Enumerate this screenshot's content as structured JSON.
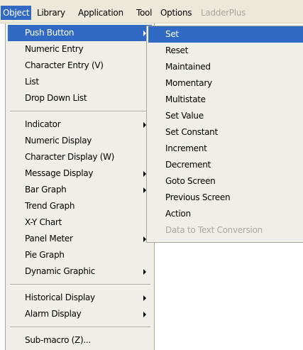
{
  "menubar": {
    "items": [
      {
        "label": "Object",
        "state": "active"
      },
      {
        "label": "Library",
        "state": "normal"
      },
      {
        "label": "Application",
        "state": "normal"
      },
      {
        "label": "Tool",
        "state": "normal"
      },
      {
        "label": "Options",
        "state": "normal"
      },
      {
        "label": "LadderPlus",
        "state": "disabled"
      }
    ]
  },
  "object_menu": {
    "items": [
      {
        "label": "Push Button",
        "submenu": true,
        "selected": true
      },
      {
        "label": "Numeric Entry",
        "submenu": false
      },
      {
        "label": "Character Entry (V)",
        "submenu": false
      },
      {
        "label": "List",
        "submenu": false
      },
      {
        "label": "Drop Down List",
        "submenu": false
      },
      {
        "label": "Indicator",
        "submenu": true
      },
      {
        "label": "Numeric Display",
        "submenu": false
      },
      {
        "label": "Character Display (W)",
        "submenu": false
      },
      {
        "label": "Message Display",
        "submenu": true
      },
      {
        "label": "Bar Graph",
        "submenu": true
      },
      {
        "label": "Trend Graph",
        "submenu": false
      },
      {
        "label": "X-Y Chart",
        "submenu": false
      },
      {
        "label": "Panel Meter",
        "submenu": true
      },
      {
        "label": "Pie Graph",
        "submenu": false
      },
      {
        "label": "Dynamic Graphic",
        "submenu": true
      },
      {
        "label": "Historical Display",
        "submenu": true
      },
      {
        "label": "Alarm Display",
        "submenu": true
      },
      {
        "label": "Sub-macro (Z)...",
        "submenu": false
      }
    ]
  },
  "push_button_submenu": {
    "items": [
      {
        "label": "Set",
        "selected": true
      },
      {
        "label": "Reset"
      },
      {
        "label": "Maintained"
      },
      {
        "label": "Momentary"
      },
      {
        "label": "Multistate"
      },
      {
        "label": "Set Value"
      },
      {
        "label": "Set Constant"
      },
      {
        "label": "Increment"
      },
      {
        "label": "Decrement"
      },
      {
        "label": "Goto Screen"
      },
      {
        "label": "Previous Screen"
      },
      {
        "label": "Action"
      },
      {
        "label": "Data to Text Conversion",
        "disabled": true
      }
    ]
  },
  "colors": {
    "highlight": "#316ac5",
    "menu_bg": "#f0eee8",
    "menubar_bg": "#ece9d8",
    "disabled_text": "#aca899"
  }
}
